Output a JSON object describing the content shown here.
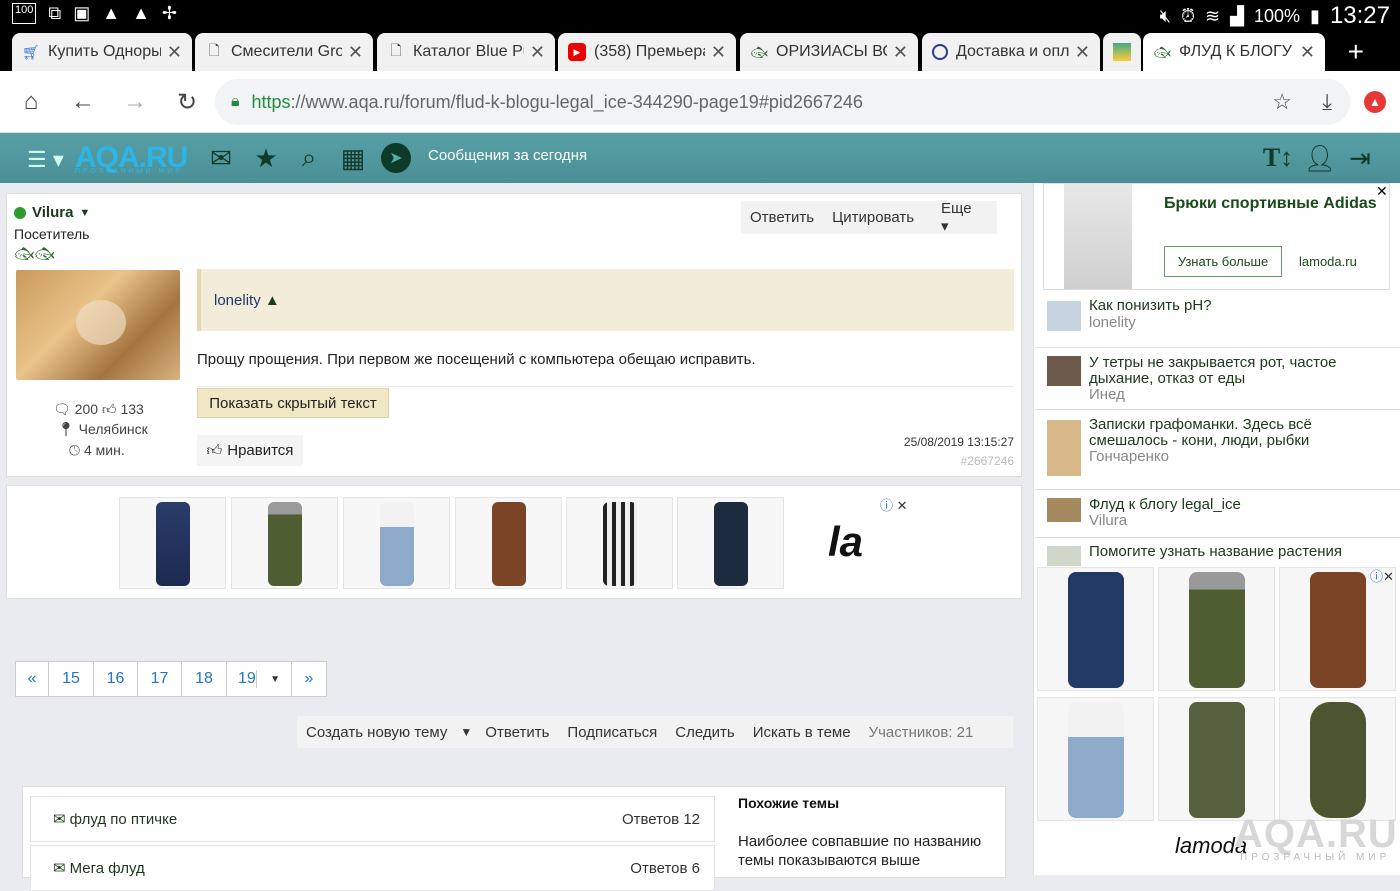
{
  "statusbar": {
    "battery": "100%",
    "time": "13:27",
    "left_icons": [
      "100",
      "cast",
      "img",
      "alert",
      "alert",
      "pinwheel"
    ]
  },
  "tabs": [
    {
      "title": "Купить Одноры",
      "icon": "cart-icon"
    },
    {
      "title": "Смесители Grol",
      "icon": "doc-icon"
    },
    {
      "title": "Каталог Blue Pu",
      "icon": "doc-icon"
    },
    {
      "title": "(358) Премьера",
      "icon": "youtube-icon"
    },
    {
      "title": "ОРИЗИАСЫ ВО",
      "icon": "fish-icon"
    },
    {
      "title": "Доставка и опл",
      "icon": "circle-icon"
    },
    {
      "title": "",
      "icon": "app-icon"
    },
    {
      "title": "ФЛУД К БЛОГУ",
      "icon": "fish-icon"
    }
  ],
  "url": {
    "scheme": "https",
    "rest": "://www.aqa.ru/forum/flud-k-blogu-legal_ice-344290-page19#pid2667246"
  },
  "site": {
    "logo": "AQA.RU",
    "logo_sub": "ПРОЗРАЧНЫЙ МИР",
    "today_link": "Сообщения за сегодня",
    "calendar_badge": "0"
  },
  "post": {
    "author": "Vilura",
    "role": "Посетитель",
    "posts": "200",
    "likes": "133",
    "city": "Челябинск",
    "time": "4 мин.",
    "actions": {
      "reply": "Ответить",
      "quote": "Цитировать",
      "more": "Еще"
    },
    "quote_author": "lonelity",
    "text": "Прощу прощения. При первом же посещений с компьютера обещаю исправить.",
    "hidden_btn": "Показать скрытый текст",
    "like_btn": "Нравится",
    "date": "25/08/2019 13:15:27",
    "pid": "#2667246"
  },
  "ad": {
    "brand_short": "la"
  },
  "pager": {
    "prev": "«",
    "pages": [
      "15",
      "16",
      "17",
      "18"
    ],
    "current": "19",
    "next": "»"
  },
  "topicbar": {
    "create": "Создать новую тему",
    "reply": "Ответить",
    "subscribe": "Подписаться",
    "follow": "Следить",
    "search": "Искать в теме",
    "participants": "Участников: 21"
  },
  "similar": {
    "rows": [
      {
        "title": "флуд по птичке",
        "count": "Ответов 12"
      },
      {
        "title": "Мега флуд",
        "count": "Ответов 6"
      }
    ],
    "head": "Похожие темы",
    "note": "Наиболее совпавшие по названию темы показываются выше"
  },
  "sidebar": {
    "ad": {
      "title": "Брюки спортивные Adidas",
      "button": "Узнать больше",
      "domain": "lamoda.ru"
    },
    "items": [
      {
        "title": "Как понизить pH?",
        "author": "lonelity"
      },
      {
        "title": "У тетры не закрывается рот, частое дыхание, отказ от еды",
        "author": "Инед"
      },
      {
        "title": "Записки графоманки. Здесь всё смешалось - кони, люди, рыбки",
        "author": "Гончаренко"
      },
      {
        "title": "Флуд к блогу legal_ice",
        "author": "Vilura"
      },
      {
        "title": "Помогите узнать название растения",
        "author": ""
      }
    ],
    "ad2_brand": "lamoda",
    "watermark": "AQA.RU",
    "watermark_sub": "ПРОЗРАЧНЫЙ МИР"
  }
}
